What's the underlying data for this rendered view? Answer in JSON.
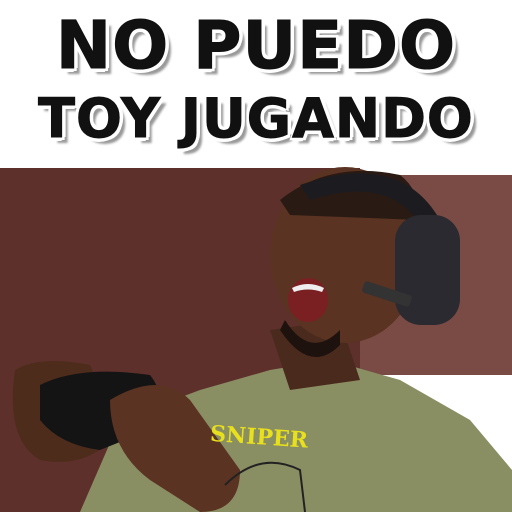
{
  "caption": {
    "line1": "NO PUEDO",
    "line2": "TOY JUGANDO"
  },
  "photo": {
    "shirt_text": "SNIPER"
  },
  "colors": {
    "background": "#5e302c",
    "shirt": "#8a8e63",
    "skin": "#5a3322",
    "shirt_text": "#e8e01c",
    "caption": "#111111"
  }
}
